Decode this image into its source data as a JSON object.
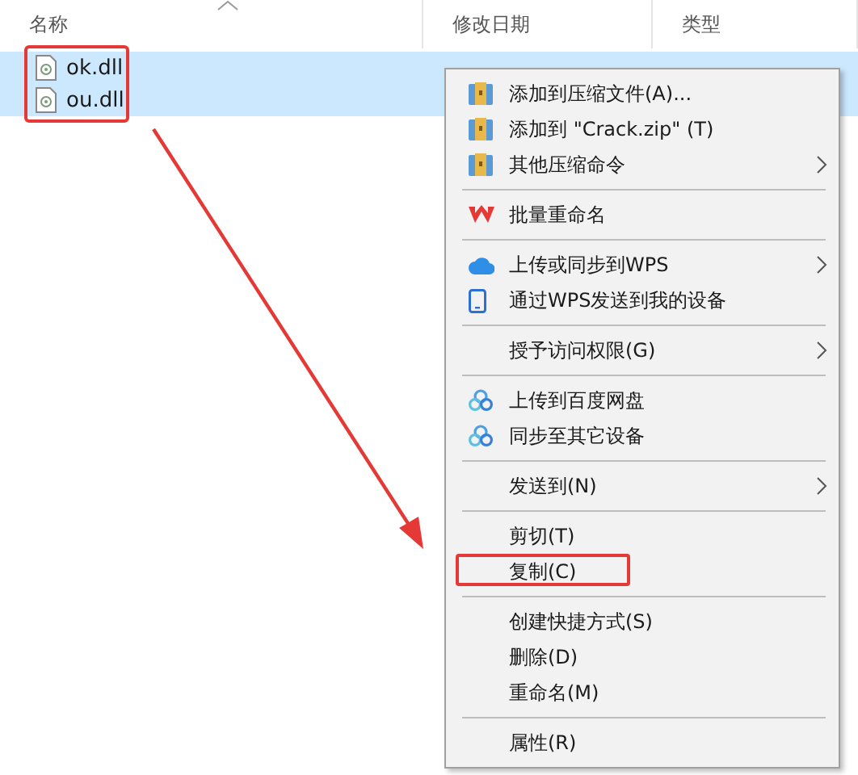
{
  "columns": [
    {
      "label": "名称",
      "sort_icon": true
    },
    {
      "label": "修改日期",
      "sort_icon": false
    },
    {
      "label": "类型",
      "sort_icon": false
    }
  ],
  "files": [
    {
      "name": "ok.dll",
      "selected": true
    },
    {
      "name": "ou.dll",
      "selected": true
    }
  ],
  "context_menu": [
    {
      "kind": "archive",
      "label": "添加到压缩文件(A)...",
      "submenu": false,
      "highlighted": false
    },
    {
      "kind": "archive",
      "label": "添加到 \"Crack.zip\" (T)",
      "submenu": false,
      "highlighted": false
    },
    {
      "kind": "archive",
      "label": "其他压缩命令",
      "submenu": true,
      "highlighted": false
    },
    {
      "kind": "separator"
    },
    {
      "kind": "wps",
      "label": "批量重命名",
      "submenu": false,
      "highlighted": false
    },
    {
      "kind": "separator"
    },
    {
      "kind": "cloud",
      "label": "上传或同步到WPS",
      "submenu": true,
      "highlighted": false
    },
    {
      "kind": "phone",
      "label": "通过WPS发送到我的设备",
      "submenu": false,
      "highlighted": false
    },
    {
      "kind": "separator"
    },
    {
      "kind": "plain",
      "label": "授予访问权限(G)",
      "submenu": true,
      "highlighted": false
    },
    {
      "kind": "separator"
    },
    {
      "kind": "baidu",
      "label": "上传到百度网盘",
      "submenu": false,
      "highlighted": false
    },
    {
      "kind": "baidu",
      "label": "同步至其它设备",
      "submenu": false,
      "highlighted": false
    },
    {
      "kind": "separator"
    },
    {
      "kind": "plain",
      "label": "发送到(N)",
      "submenu": true,
      "highlighted": false
    },
    {
      "kind": "separator"
    },
    {
      "kind": "plain",
      "label": "剪切(T)",
      "submenu": false,
      "highlighted": false
    },
    {
      "kind": "plain",
      "label": "复制(C)",
      "submenu": false,
      "highlighted": true
    },
    {
      "kind": "separator"
    },
    {
      "kind": "plain",
      "label": "创建快捷方式(S)",
      "submenu": false,
      "highlighted": false
    },
    {
      "kind": "plain",
      "label": "删除(D)",
      "submenu": false,
      "highlighted": false
    },
    {
      "kind": "plain",
      "label": "重命名(M)",
      "submenu": false,
      "highlighted": false
    },
    {
      "kind": "separator"
    },
    {
      "kind": "plain",
      "label": "属性(R)",
      "submenu": false,
      "highlighted": false
    }
  ]
}
